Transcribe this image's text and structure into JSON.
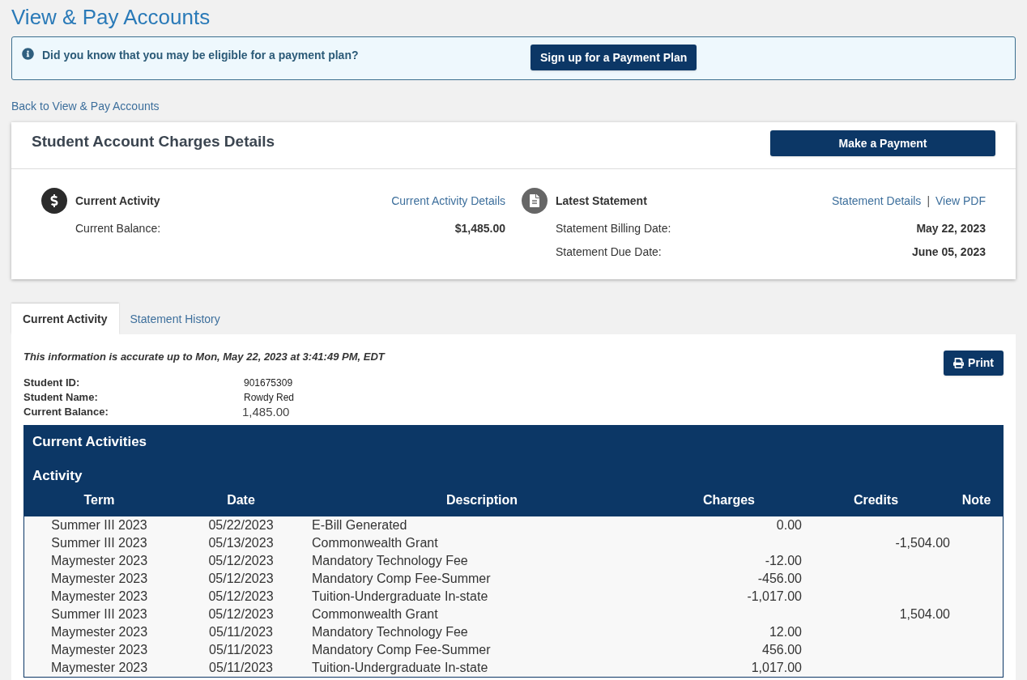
{
  "page_title": "View & Pay Accounts",
  "alert": {
    "message": "Did you know that you may be eligible for a payment plan?",
    "button": "Sign up for a Payment Plan"
  },
  "back_link": "Back to View & Pay Accounts",
  "summary": {
    "title": "Student Account Charges Details",
    "button": "Make a Payment",
    "activity": {
      "heading": "Current Activity",
      "link": "Current Activity Details",
      "rows": [
        {
          "label": "Current Balance:",
          "value": "$1,485.00"
        }
      ]
    },
    "statement": {
      "heading": "Latest Statement",
      "links": [
        "Statement Details",
        "View PDF"
      ],
      "separator": "|",
      "rows": [
        {
          "label": "Statement Billing Date:",
          "value": "May 22, 2023"
        },
        {
          "label": "Statement Due Date:",
          "value": "June 05, 2023"
        }
      ]
    }
  },
  "tabs": [
    {
      "label": "Current Activity",
      "selected": true
    },
    {
      "label": "Statement History",
      "selected": false
    }
  ],
  "panel": {
    "accuracy_note": "This information is accurate up to Mon, May 22, 2023 at 3:41:49 PM, EDT",
    "print_button": "Print",
    "student": [
      {
        "label": "Student ID:",
        "value": "901675309"
      },
      {
        "label": "Student Name:",
        "value": "Rowdy Red"
      },
      {
        "label": "Current Balance:",
        "value": "1,485.00"
      }
    ],
    "table": {
      "title": "Current Activities",
      "subtitle": "Activity",
      "columns": [
        "Term",
        "Date",
        "Description",
        "Charges",
        "Credits",
        "Note"
      ],
      "rows": [
        {
          "term": "Summer III 2023",
          "date": "05/22/2023",
          "description": "E-Bill Generated",
          "charges": "0.00"
        },
        {
          "term": "Summer III 2023",
          "date": "05/13/2023",
          "description": "Commonwealth Grant",
          "credits": "-1,504.00"
        },
        {
          "term": "Maymester 2023",
          "date": "05/12/2023",
          "description": "Mandatory Technology Fee",
          "charges": "-12.00"
        },
        {
          "term": "Maymester 2023",
          "date": "05/12/2023",
          "description": "Mandatory Comp Fee-Summer",
          "charges": "-456.00"
        },
        {
          "term": "Maymester 2023",
          "date": "05/12/2023",
          "description": "Tuition-Undergraduate In-state",
          "charges": "-1,017.00"
        },
        {
          "term": "Summer III 2023",
          "date": "05/12/2023",
          "description": "Commonwealth Grant",
          "credits": "1,504.00"
        },
        {
          "term": "Maymester 2023",
          "date": "05/11/2023",
          "description": "Mandatory Technology Fee",
          "charges": "12.00"
        },
        {
          "term": "Maymester 2023",
          "date": "05/11/2023",
          "description": "Mandatory Comp Fee-Summer",
          "charges": "456.00"
        },
        {
          "term": "Maymester 2023",
          "date": "05/11/2023",
          "description": "Tuition-Undergraduate In-state",
          "charges": "1,017.00"
        }
      ]
    }
  }
}
